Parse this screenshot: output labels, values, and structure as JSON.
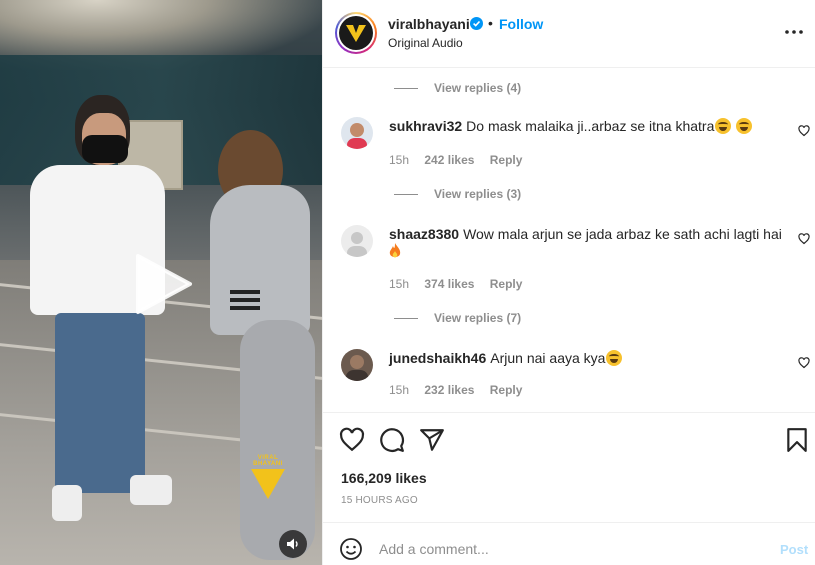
{
  "post": {
    "username": "viralbhayani",
    "follow_label": "Follow",
    "separator": "•",
    "audio": "Original Audio",
    "watermark": "VIRAL BHAYANI"
  },
  "comments": {
    "view_replies_1": "View replies (4)",
    "items": [
      {
        "user": "sukhravi32",
        "text": "Do mask malaika ji..arbaz se itna khatra",
        "time": "15h",
        "likes": "242 likes",
        "reply": "Reply",
        "replies": "View replies (3)"
      },
      {
        "user": "shaaz8380",
        "text": "Wow mala arjun se jada arbaz ke sath achi lagti hai",
        "time": "15h",
        "likes": "374 likes",
        "reply": "Reply",
        "replies": "View replies (7)"
      },
      {
        "user": "junedshaikh46",
        "text": "Arjun nai aaya kya",
        "time": "15h",
        "likes": "232 likes",
        "reply": "Reply"
      }
    ]
  },
  "actions": {
    "likes": "166,209 likes",
    "time": "15 HOURS AGO"
  },
  "add_comment": {
    "placeholder": "Add a comment...",
    "post_label": "Post"
  },
  "icons": {
    "like": "heart-icon",
    "comment": "comment-icon",
    "share": "share-icon",
    "save": "bookmark-icon",
    "more": "more-options-icon",
    "emoji": "emoji-icon",
    "play": "play-icon",
    "audio": "speaker-icon",
    "verified": "verified-badge-icon"
  },
  "colors": {
    "link_blue": "#0095f6",
    "secondary_text": "#8e8e8e",
    "post_disabled": "#b2dffc",
    "watermark_yellow": "#f2c21b"
  }
}
